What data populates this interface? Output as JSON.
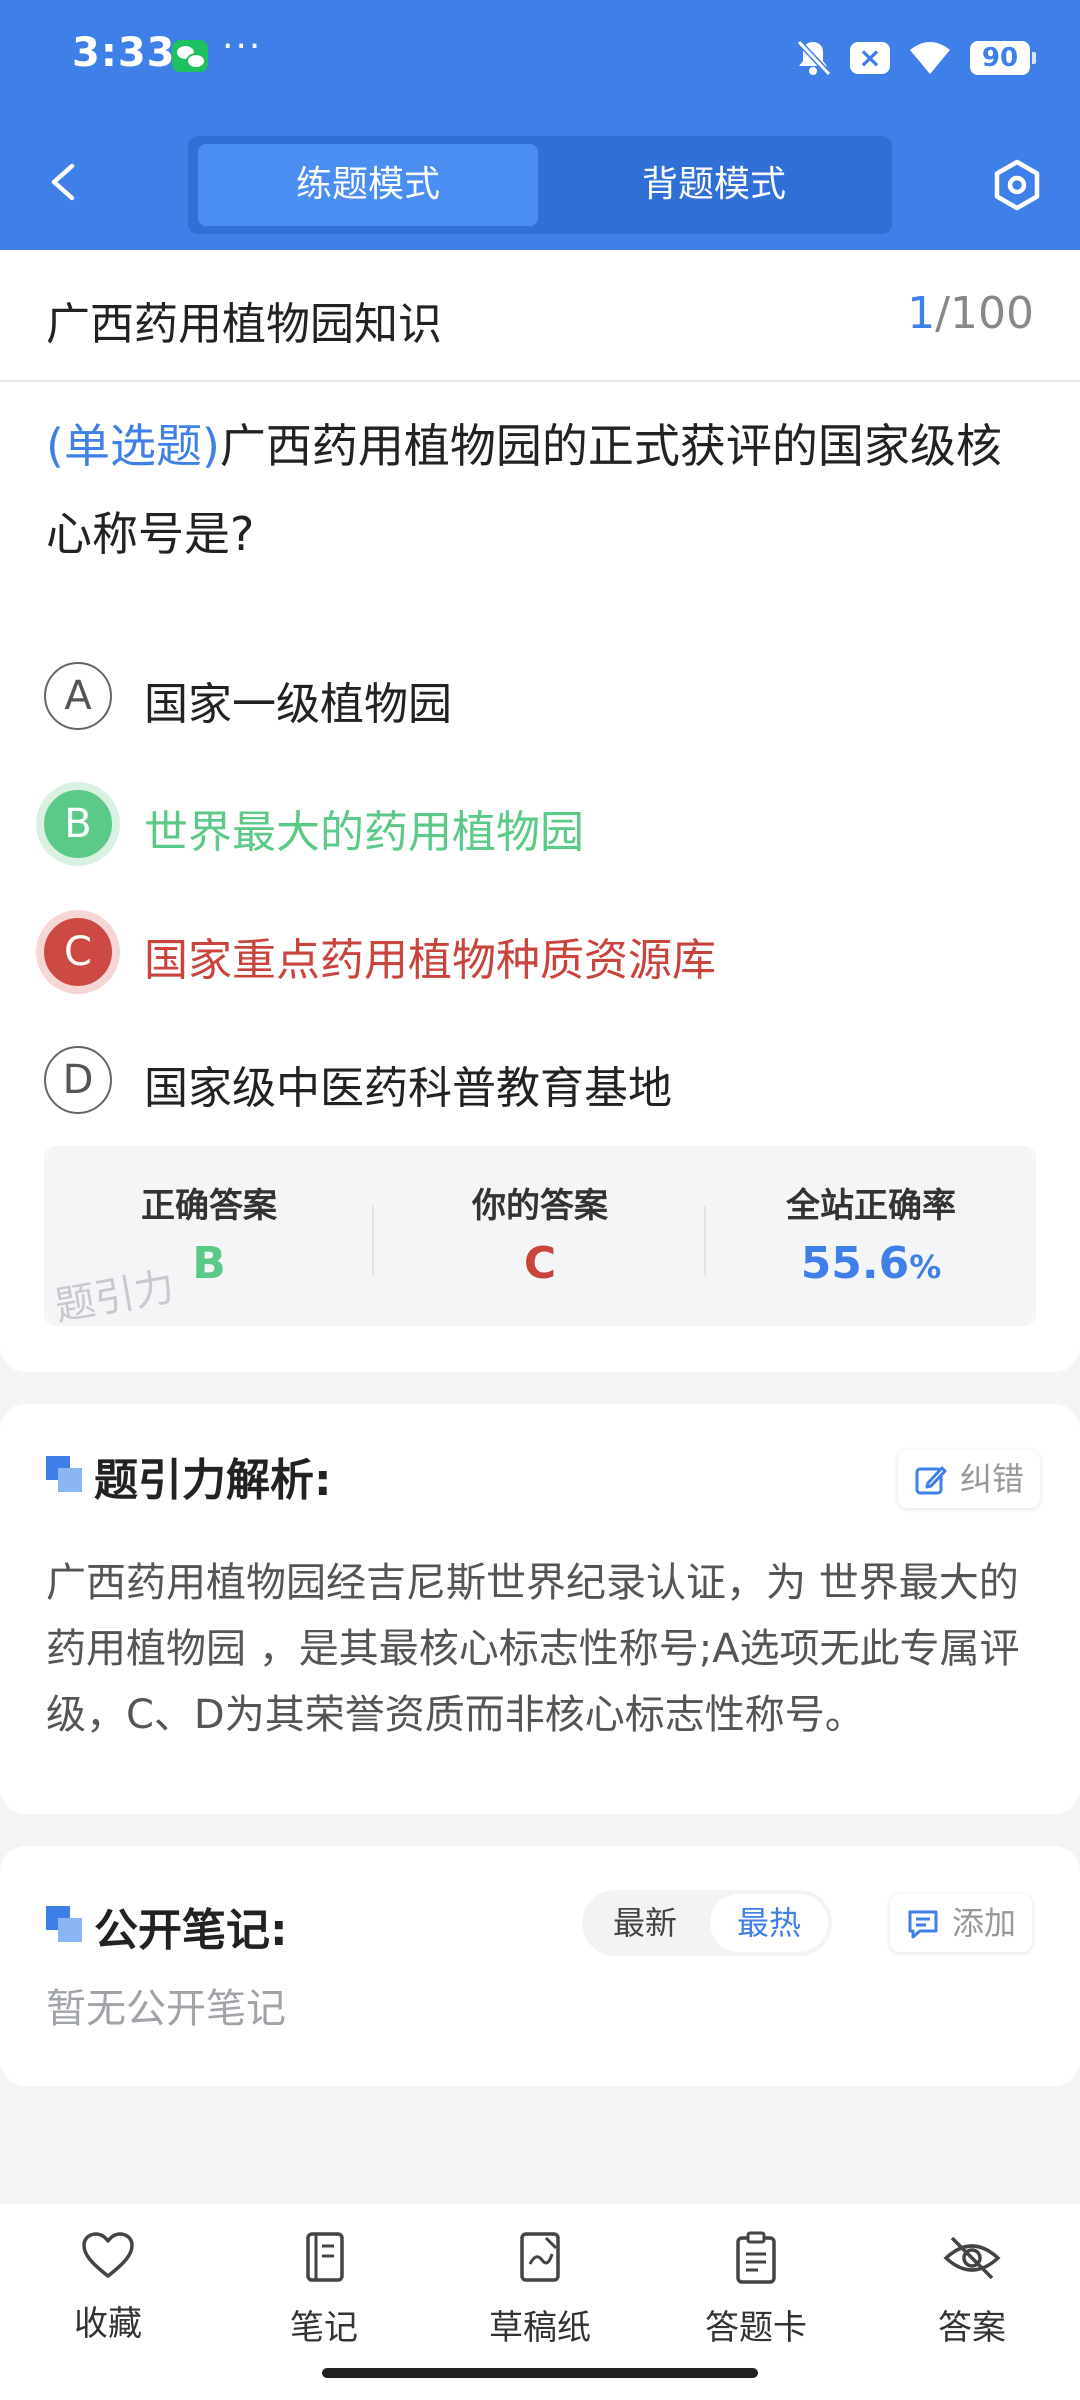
{
  "status": {
    "time": "3:33",
    "more": "···",
    "battery": "90"
  },
  "header": {
    "tabs": [
      {
        "label": "练题模式",
        "active": true
      },
      {
        "label": "背题模式",
        "active": false
      }
    ]
  },
  "question": {
    "bank_title": "广西药用植物园知识",
    "current": "1",
    "total": "/100",
    "type": "(单选题)",
    "text": "广西药用植物园的正式获评的国家级核心称号是?",
    "options": [
      {
        "letter": "A",
        "text": "国家一级植物园",
        "state": "normal"
      },
      {
        "letter": "B",
        "text": "世界最大的药用植物园",
        "state": "correct"
      },
      {
        "letter": "C",
        "text": "国家重点药用植物种质资源库",
        "state": "wrong"
      },
      {
        "letter": "D",
        "text": "国家级中医药科普教育基地",
        "state": "normal"
      }
    ]
  },
  "answer_summary": {
    "correct_label": "正确答案",
    "correct_value": "B",
    "yours_label": "你的答案",
    "yours_value": "C",
    "rate_label": "全站正确率",
    "rate_value": "55.6",
    "rate_unit": "%",
    "watermark": "题引力"
  },
  "analysis": {
    "title": "题引力解析:",
    "report_button": "纠错",
    "text": "广西药用植物园经吉尼斯世界纪录认证，为 世界最大的药用植物园 ，是其最核心标志性称号;A选项无此专属评级，C、D为其荣誉资质而非核心标志性称号。"
  },
  "notes": {
    "title": "公开笔记:",
    "sort_options": [
      "最新",
      "最热"
    ],
    "sort_selected": "最热",
    "add_button": "添加",
    "empty_text": "暂无公开笔记"
  },
  "bottom_nav": [
    {
      "label": "收藏",
      "icon": "heart-icon"
    },
    {
      "label": "笔记",
      "icon": "notebook-icon"
    },
    {
      "label": "草稿纸",
      "icon": "draft-paper-icon"
    },
    {
      "label": "答题卡",
      "icon": "answer-card-icon"
    },
    {
      "label": "答案",
      "icon": "eye-off-icon"
    }
  ],
  "colors": {
    "primary": "#3f7fe8",
    "correct": "#5bc987",
    "wrong": "#c9443d",
    "background": "#f3f4f6"
  }
}
